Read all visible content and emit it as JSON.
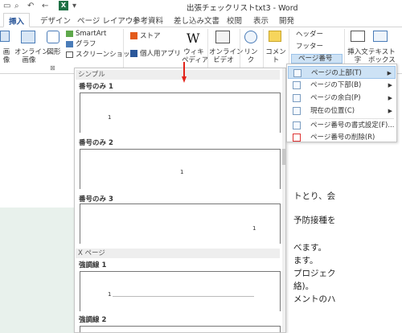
{
  "window": {
    "title": "出張チェックリストtxt3 - Word"
  },
  "tabs": [
    "挿入",
    "デザイン",
    "ページ レイアウト",
    "参考資料",
    "差し込み文書",
    "校閲",
    "表示",
    "開発"
  ],
  "ribbon": {
    "image": "画像",
    "online_image": "オンライン\n画像",
    "shapes": "図形",
    "smartart": "SmartArt",
    "graph": "グラフ",
    "screenshot": "スクリーンショット",
    "store": "ストア",
    "personal_apps": "個人用アプリ",
    "wikipedia": "ウィキ\nペディア",
    "online_video": "オンライン\nビデオ",
    "link": "リンク",
    "comment": "コメント",
    "header": "ヘッダー",
    "footer": "フッター",
    "page_number": "ページ番号",
    "textbox": "テキスト\nボックス",
    "quickparts": "挿入文\n字"
  },
  "gallery": {
    "section1": "シンプル",
    "items1": [
      "番号のみ 1",
      "番号のみ 2",
      "番号のみ 3"
    ],
    "section2": "X ページ",
    "items2": [
      "強調線 1",
      "強調線 2"
    ],
    "num_glyph": "1"
  },
  "submenu": {
    "items": [
      {
        "label": "ページの上部(T)",
        "arrow": "▶"
      },
      {
        "label": "ページの下部(B)",
        "arrow": "▶"
      },
      {
        "label": "ページの余白(P)",
        "arrow": "▶"
      },
      {
        "label": "現在の位置(C)",
        "arrow": "▶"
      },
      {
        "label": "ページ番号の書式設定(F)..."
      },
      {
        "label": "ページ番号の削除(R)"
      }
    ]
  },
  "document": {
    "lines": [
      "トとり、会",
      "予防接種を",
      "べます。",
      "ます。",
      "プロジェク",
      "絡)。",
      "メントのハ"
    ]
  }
}
